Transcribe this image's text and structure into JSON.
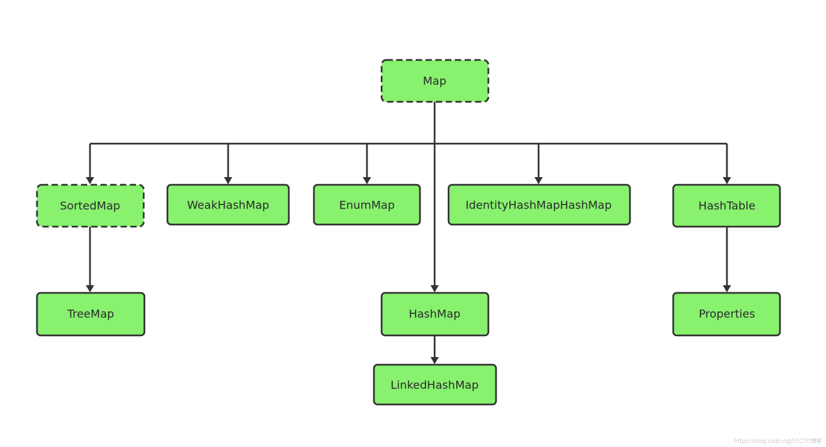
{
  "diagram": {
    "nodes": [
      {
        "id": "map",
        "label": "Map",
        "style": "dashed"
      },
      {
        "id": "sortedmap",
        "label": "SortedMap",
        "style": "dashed"
      },
      {
        "id": "weakhashmap",
        "label": "WeakHashMap",
        "style": "solid"
      },
      {
        "id": "enummap",
        "label": "EnumMap",
        "style": "solid"
      },
      {
        "id": "identityhashmap",
        "label": "IdentityHashMapHashMap",
        "style": "solid"
      },
      {
        "id": "hashtable",
        "label": "HashTable",
        "style": "solid"
      },
      {
        "id": "treemap",
        "label": "TreeMap",
        "style": "solid"
      },
      {
        "id": "hashmap",
        "label": "HashMap",
        "style": "solid"
      },
      {
        "id": "linkedhashmap",
        "label": "LinkedHashMap",
        "style": "solid"
      },
      {
        "id": "properties",
        "label": "Properties",
        "style": "solid"
      }
    ],
    "edges": [
      {
        "from": "map",
        "to": "sortedmap"
      },
      {
        "from": "map",
        "to": "weakhashmap"
      },
      {
        "from": "map",
        "to": "enummap"
      },
      {
        "from": "map",
        "to": "identityhashmap"
      },
      {
        "from": "map",
        "to": "hashtable"
      },
      {
        "from": "map",
        "to": "hashmap"
      },
      {
        "from": "sortedmap",
        "to": "treemap"
      },
      {
        "from": "hashmap",
        "to": "linkedhashmap"
      },
      {
        "from": "hashtable",
        "to": "properties"
      }
    ],
    "colors": {
      "node_fill": "#88f26f",
      "stroke": "#333333"
    }
  },
  "watermark": "https://blog.csdn.n@51CTO博客"
}
